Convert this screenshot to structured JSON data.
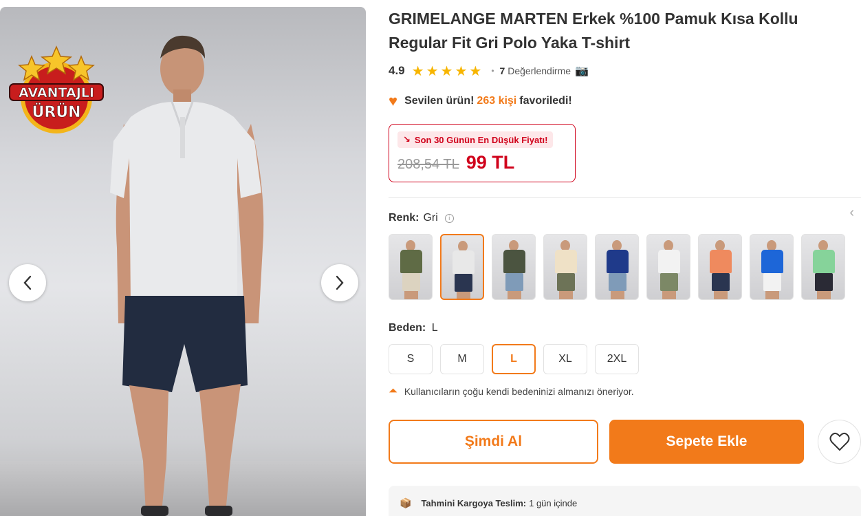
{
  "product": {
    "brand": "GRIMELANGE",
    "title": "MARTEN Erkek %100 Pamuk Kısa Kollu Regular Fit Gri Polo Yaka T-shirt",
    "rating": "4.9",
    "review_count": "7",
    "review_label": "Değerlendirme",
    "stars": 5
  },
  "badge": {
    "line1": "AVANTAJLI",
    "line2": "ÜRÜN"
  },
  "favorite": {
    "prefix": "Sevilen ürün!",
    "count": "263 kişi",
    "suffix": "favoriledi!"
  },
  "price": {
    "tag": "Son 30 Günün En Düşük Fiyatı!",
    "old": "208,54 TL",
    "new": "99 TL"
  },
  "color": {
    "label": "Renk:",
    "value": "Gri",
    "swatches": [
      {
        "shirt": "#5f6b45",
        "pants": "#dcd3c0",
        "selected": false
      },
      {
        "shirt": "#e8e8e8",
        "pants": "#2a3550",
        "selected": true
      },
      {
        "shirt": "#4b5440",
        "pants": "#7f9bb8",
        "selected": false
      },
      {
        "shirt": "#efe1c6",
        "pants": "#6d7357",
        "selected": false
      },
      {
        "shirt": "#1f3a8a",
        "pants": "#7f9bb8",
        "selected": false
      },
      {
        "shirt": "#f2f2f2",
        "pants": "#7c8866",
        "selected": false
      },
      {
        "shirt": "#ef8a5e",
        "pants": "#2a3550",
        "selected": false
      },
      {
        "shirt": "#1d66d8",
        "pants": "#f2f2f2",
        "selected": false
      },
      {
        "shirt": "#86d39a",
        "pants": "#2a2a35",
        "selected": false
      }
    ]
  },
  "size": {
    "label": "Beden:",
    "value": "L",
    "options": [
      "S",
      "M",
      "L",
      "XL",
      "2XL"
    ],
    "selected": "L"
  },
  "recommendation": "Kullanıcıların çoğu kendi bedeninizi almanızı öneriyor.",
  "buttons": {
    "buy_now": "Şimdi Al",
    "add_to_cart": "Sepete Ekle"
  },
  "delivery": {
    "label": "Tahmini Kargoya Teslim:",
    "value": "1 gün içinde"
  },
  "colors": {
    "accent": "#f27a1a",
    "price_red": "#d0021b",
    "star": "#f7b500"
  }
}
